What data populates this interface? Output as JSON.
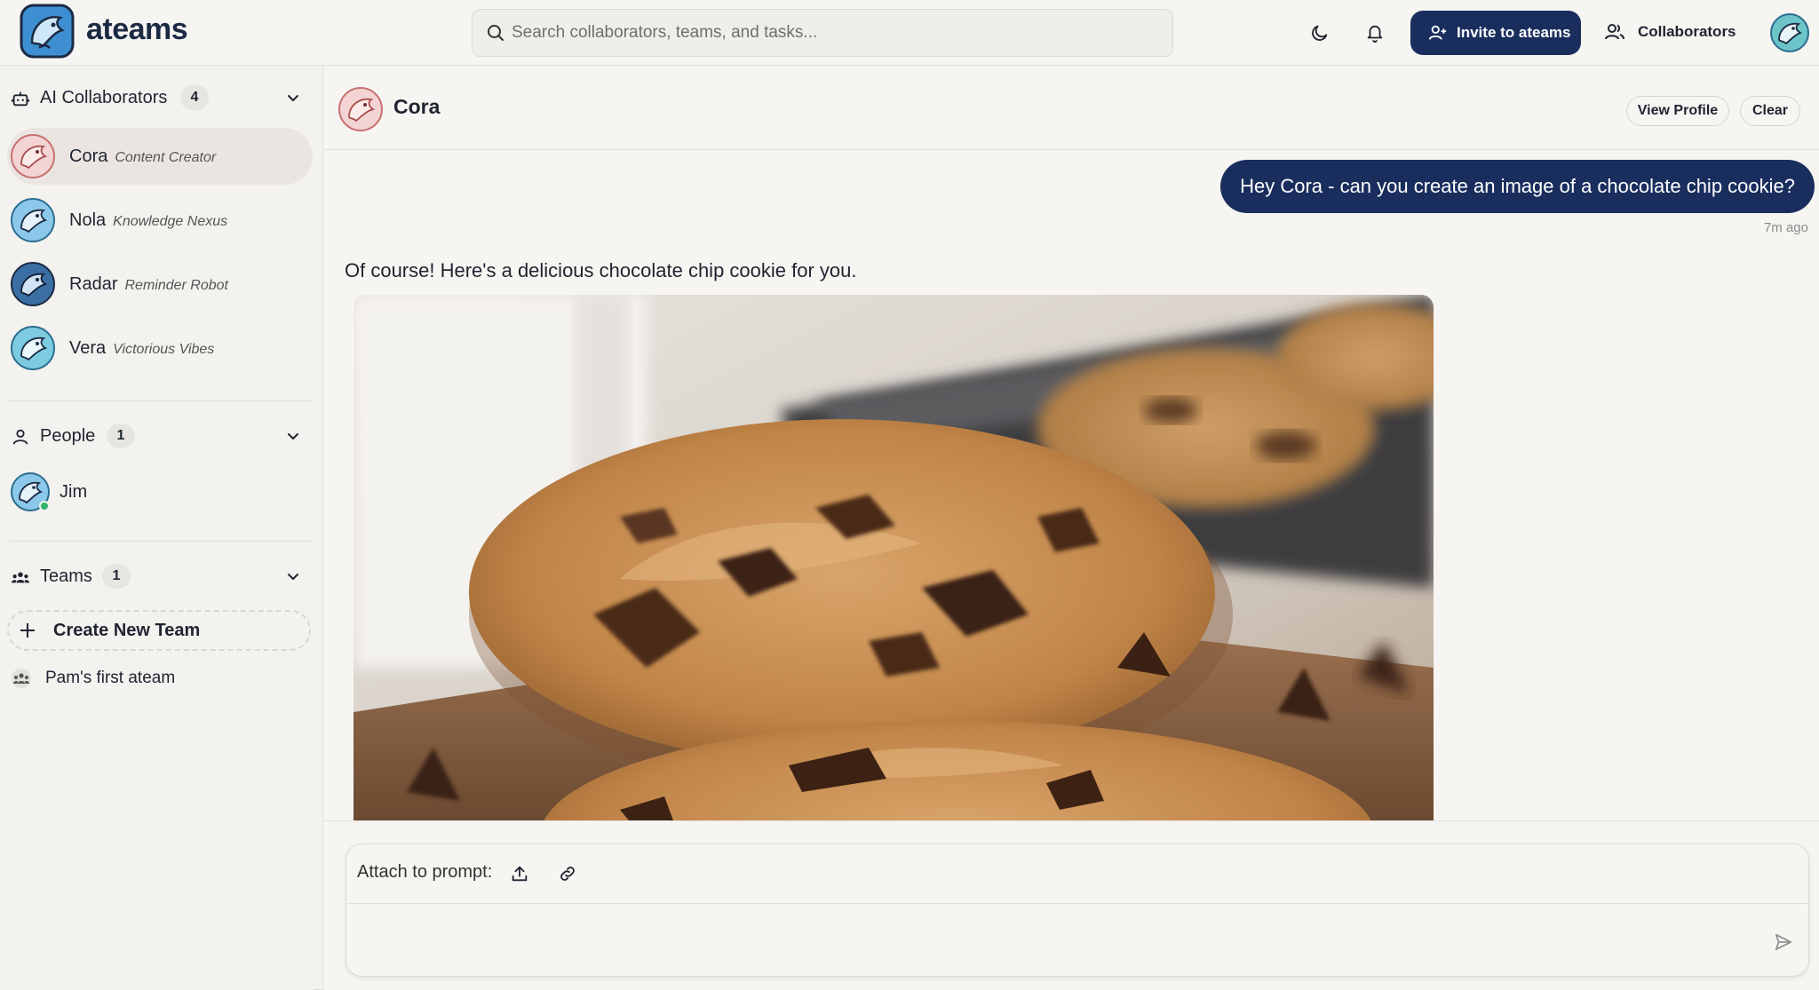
{
  "brand": {
    "name": "ateams"
  },
  "search": {
    "placeholder": "Search collaborators, teams, and tasks..."
  },
  "header": {
    "invite_label": "Invite to ateams",
    "collaborators_label": "Collaborators"
  },
  "sidebar": {
    "ai_section": {
      "title": "AI Collaborators",
      "count": "4",
      "items": [
        {
          "name": "Cora",
          "role": "Content Creator",
          "active": true
        },
        {
          "name": "Nola",
          "role": "Knowledge Nexus"
        },
        {
          "name": "Radar",
          "role": "Reminder Robot"
        },
        {
          "name": "Vera",
          "role": "Victorious Vibes"
        }
      ]
    },
    "people_section": {
      "title": "People",
      "count": "1",
      "items": [
        {
          "name": "Jim",
          "status": "online"
        }
      ]
    },
    "teams_section": {
      "title": "Teams",
      "count": "1",
      "create_label": "Create New Team",
      "items": [
        {
          "name": "Pam's first ateam"
        }
      ]
    }
  },
  "chat": {
    "name": "Cora",
    "view_profile_label": "View Profile",
    "clear_label": "Clear",
    "messages": [
      {
        "from": "user",
        "text": "Hey Cora - can you create an image of a chocolate chip cookie?",
        "time": "7m ago"
      },
      {
        "from": "ai",
        "text": "Of course! Here's a delicious chocolate chip cookie for you."
      }
    ],
    "composer": {
      "attach_label": "Attach to prompt:",
      "placeholder": ""
    }
  },
  "colors": {
    "navy": "#1a2e5e",
    "background": "#f6f5f2",
    "sidebar": "#f3f2ef",
    "active_item": "#ebe5e2",
    "online": "#2fb36a"
  }
}
